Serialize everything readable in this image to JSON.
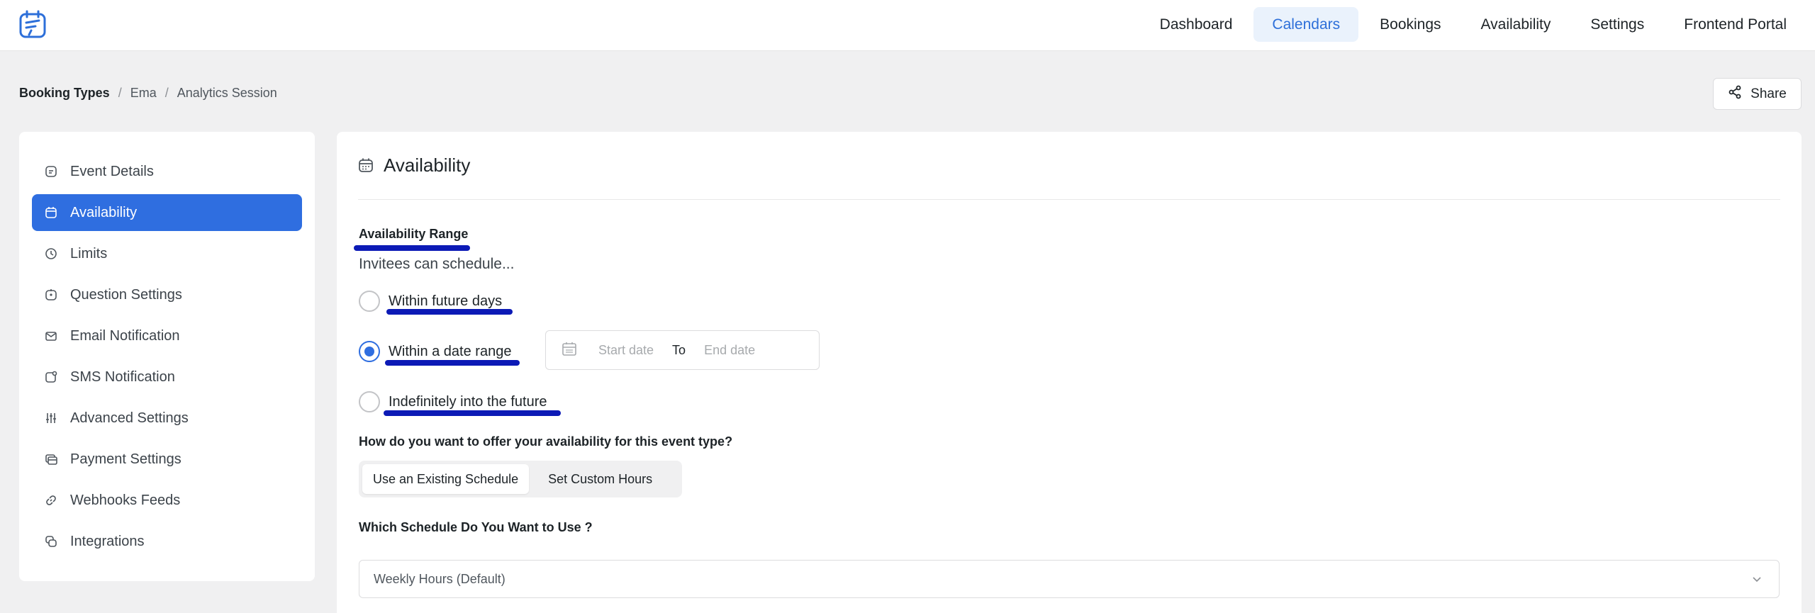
{
  "nav": {
    "items": [
      {
        "label": "Dashboard",
        "active": false
      },
      {
        "label": "Calendars",
        "active": true
      },
      {
        "label": "Bookings",
        "active": false
      },
      {
        "label": "Availability",
        "active": false
      },
      {
        "label": "Settings",
        "active": false
      },
      {
        "label": "Frontend Portal",
        "active": false
      }
    ]
  },
  "breadcrumb": {
    "root": "Booking Types",
    "middle": "Ema",
    "current": "Analytics Session",
    "separator": "/"
  },
  "share_label": "Share",
  "sidebar": {
    "items": [
      {
        "label": "Event Details",
        "icon": "event-details-icon"
      },
      {
        "label": "Availability",
        "icon": "calendar-icon",
        "active": true
      },
      {
        "label": "Limits",
        "icon": "clock-icon"
      },
      {
        "label": "Question Settings",
        "icon": "question-icon"
      },
      {
        "label": "Email Notification",
        "icon": "mail-icon"
      },
      {
        "label": "SMS Notification",
        "icon": "sms-icon"
      },
      {
        "label": "Advanced Settings",
        "icon": "sliders-icon"
      },
      {
        "label": "Payment Settings",
        "icon": "payment-icon"
      },
      {
        "label": "Webhooks Feeds",
        "icon": "link-icon"
      },
      {
        "label": "Integrations",
        "icon": "integrations-icon"
      }
    ]
  },
  "main": {
    "title": "Availability",
    "range_label": "Availability Range",
    "invitees_text": "Invitees can schedule...",
    "options": [
      {
        "label": "Within future days",
        "checked": false
      },
      {
        "label": "Within a date range",
        "checked": true
      },
      {
        "label": "Indefinitely into the future",
        "checked": false
      }
    ],
    "date_range": {
      "start_placeholder": "Start date",
      "to": "To",
      "end_placeholder": "End date"
    },
    "offer_question": "How do you want to offer your availability for this event type?",
    "segments": [
      {
        "label": "Use an Existing Schedule",
        "active": true
      },
      {
        "label": "Set Custom Hours",
        "active": false
      }
    ],
    "which_question": "Which Schedule Do You Want to Use ?",
    "schedule_value": "Weekly Hours (Default)"
  },
  "colors": {
    "accent": "#2f6ee0",
    "annotation_underline": "#0c1ab6",
    "page_bg": "#f0f0f1"
  }
}
